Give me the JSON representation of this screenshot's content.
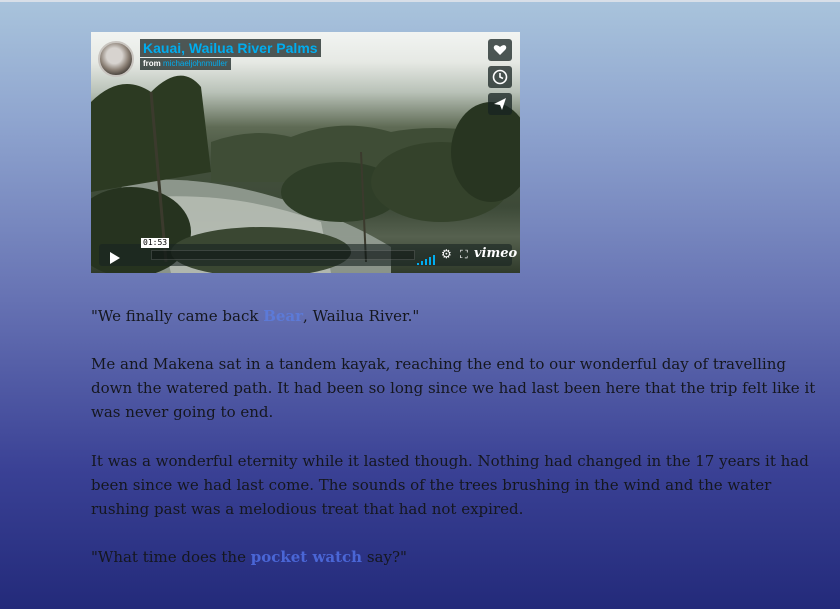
{
  "video": {
    "title": "Kauai, Wailua River Palms",
    "from_label": "from",
    "user": "michaeljohnmuller",
    "time": "01:53",
    "logo": "vimeo",
    "side_buttons": [
      "heart-icon",
      "clock-icon",
      "send-icon"
    ],
    "control_icons": [
      "play-icon",
      "volume-icon",
      "gear-icon",
      "fullscreen-icon"
    ]
  },
  "story": {
    "p1_before": "\"We finally came back ",
    "p1_link": "Bear",
    "p1_after": ", Wailua River.\"",
    "p2": "Me and Makena sat in a tandem kayak, reaching the end to our wonderful day of travelling down the watered path. It had been so long since we had last been here that the trip felt like it was never going to end.",
    "p3": "It was a wonderful eternity while it lasted though. Nothing had changed in the 17 years it had been since we had last come. The sounds of the trees brushing in the wind and the water rushing past was a melodious treat that had not expired.",
    "p4_before": "\"What time does the ",
    "p4_link": "pocket watch",
    "p4_after": " say?\""
  },
  "colors": {
    "accent": "#00adef",
    "link": "#4a66d6",
    "bg_top": "#a9c4dc",
    "bg_bottom": "#232a7a"
  }
}
